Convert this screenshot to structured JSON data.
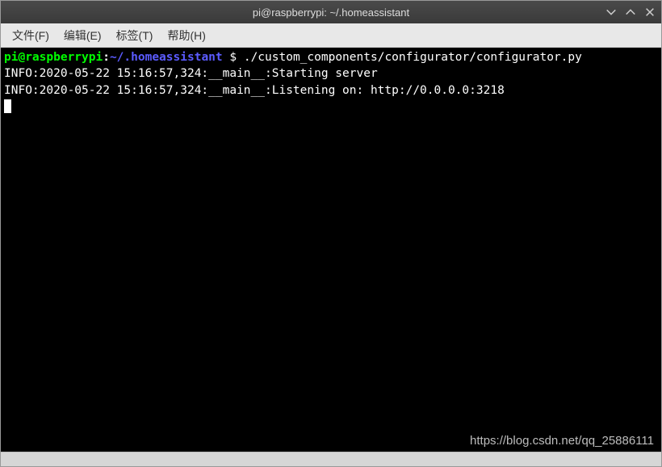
{
  "titlebar": {
    "title": "pi@raspberrypi: ~/.homeassistant"
  },
  "menubar": {
    "file": "文件(F)",
    "edit": "编辑(E)",
    "tabs": "标签(T)",
    "help": "帮助(H)"
  },
  "terminal": {
    "prompt_user": "pi@raspberrypi",
    "prompt_colon": ":",
    "prompt_path": "~/.homeassistant",
    "prompt_dollar": " $ ",
    "command": "./custom_components/configurator/configurator.py",
    "lines": [
      "INFO:2020-05-22 15:16:57,324:__main__:Starting server",
      "INFO:2020-05-22 15:16:57,324:__main__:Listening on: http://0.0.0.0:3218"
    ]
  },
  "watermark": "https://blog.csdn.net/qq_25886111"
}
